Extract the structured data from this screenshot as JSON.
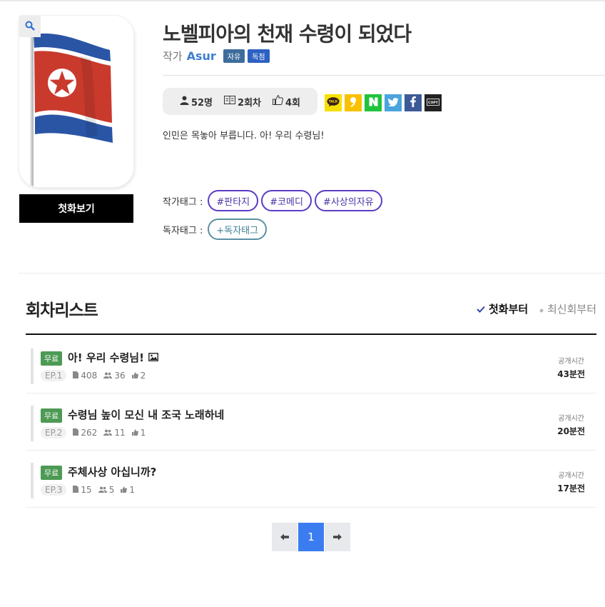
{
  "novel": {
    "title": "노벨피아의 천재 수령이 되었다",
    "author_label": "작가",
    "author_name": "Asur",
    "badges": [
      "자유",
      "독점"
    ],
    "first_view_button": "첫화보기",
    "stats": {
      "readers": "52명",
      "episodes": "2회차",
      "recommends": "4회"
    },
    "synopsis": "인민은 목놓아 부릅니다. 아! 우리 수령님!",
    "author_tags_label": "작가태그 :",
    "author_tags": [
      "#판타지",
      "#코메디",
      "#사상의자유"
    ],
    "reader_tags_label": "독자태그 :",
    "reader_tag_button": "+독자태그"
  },
  "share": {
    "icons": [
      "kakaotalk-icon",
      "kakaostory-icon",
      "naver-icon",
      "twitter-icon",
      "facebook-icon",
      "copy-link-icon"
    ],
    "labels": [
      "TALK",
      "❜",
      "N",
      "t",
      "f",
      "COPY"
    ],
    "colors": [
      "#f7e000",
      "#f9c100",
      "#20c33c",
      "#4aa4de",
      "#3d5a98",
      "#222222"
    ]
  },
  "episode_list": {
    "title": "회차리스트",
    "sort_first": "첫화부터",
    "sort_latest": "최신회부터",
    "free_label": "무료",
    "time_label": "공개시간",
    "episodes": [
      {
        "no": "EP.1",
        "title": "아! 우리 수령님!",
        "has_image": true,
        "views": "408",
        "readers": "36",
        "likes": "2",
        "time": "43분전"
      },
      {
        "no": "EP.2",
        "title": "수령님 높이 모신 내 조국 노래하네",
        "has_image": false,
        "views": "262",
        "readers": "11",
        "likes": "1",
        "time": "20분전"
      },
      {
        "no": "EP.3",
        "title": "주체사상 아십니까?",
        "has_image": false,
        "views": "15",
        "readers": "5",
        "likes": "1",
        "time": "17분전"
      }
    ]
  },
  "pagination": {
    "current": "1"
  },
  "colors": {
    "accent": "#3b7df0",
    "tag_border": "#5b3cc4",
    "free_badge": "#4d9a55"
  }
}
